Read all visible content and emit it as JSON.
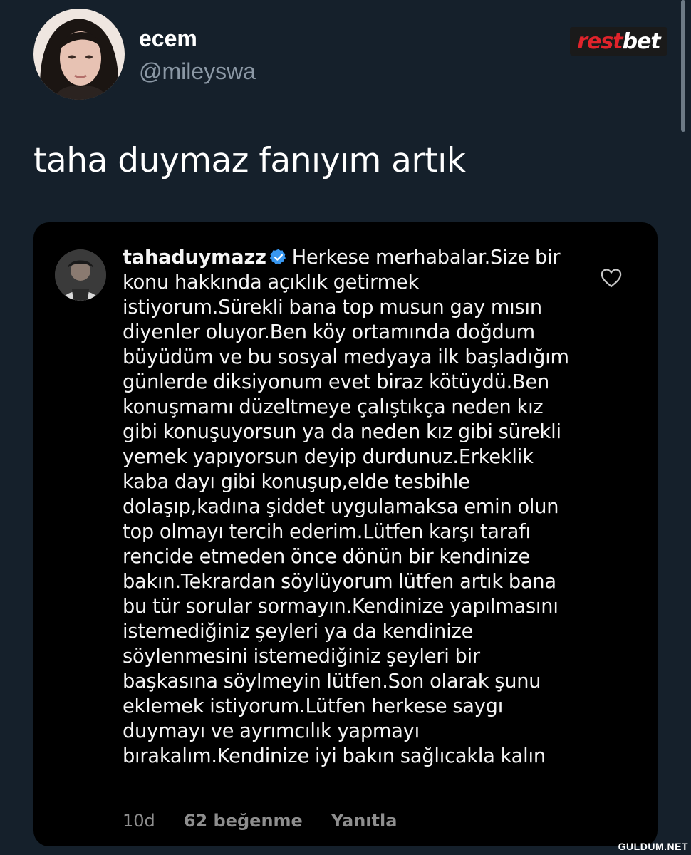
{
  "header": {
    "display_name": "ecem",
    "handle": "@mileyswa"
  },
  "brand": {
    "part1": "rest",
    "part2": "bet"
  },
  "tweet": {
    "text": "taha duymaz fanıyım artık"
  },
  "embedded_comment": {
    "username": "tahaduymazz",
    "verified": true,
    "text": "Herkese merhabalar.Size bir konu hakkında açıklık getirmek istiyorum.Sürekli bana top musun gay mısın diyenler oluyor.Ben köy ortamında doğdum büyüdüm ve bu sosyal medyaya ilk başladığım günlerde diksiyonum evet biraz kötüydü.Ben konuşmamı düzeltmeye çalıştıkça neden kız gibi konuşuyorsun ya da neden kız gibi sürekli yemek yapıyorsun deyip durdunuz.Erkeklik kaba dayı gibi konuşup,elde tesbihle dolaşıp,kadına şiddet uygulamaksa emin olun top olmayı tercih ederim.Lütfen karşı tarafı rencide etmeden önce dönün bir kendinize bakın.Tekrardan söylüyorum lütfen artık bana bu tür sorular sormayın.Kendinize yapılmasını istemediğiniz şeyleri ya da kendinize söylenmesini istemediğiniz şeyleri bir başkasına söylmeyin lütfen.Son olarak şunu eklemek istiyorum.Lütfen herkese saygı duymayı ve ayrımcılık yapmayı bırakalım.Kendinize iyi bakın sağlıcakla kalın",
    "time": "10d",
    "likes": "62 beğenme",
    "reply": "Yanıtla"
  },
  "watermark": "GULDUM.NET",
  "colors": {
    "background": "#15202b",
    "card": "#000000",
    "brand_red": "#e0232b",
    "verified_blue": "#3897f0",
    "muted": "#8e8e8e"
  },
  "icons": [
    "verified-badge-icon",
    "heart-icon"
  ]
}
